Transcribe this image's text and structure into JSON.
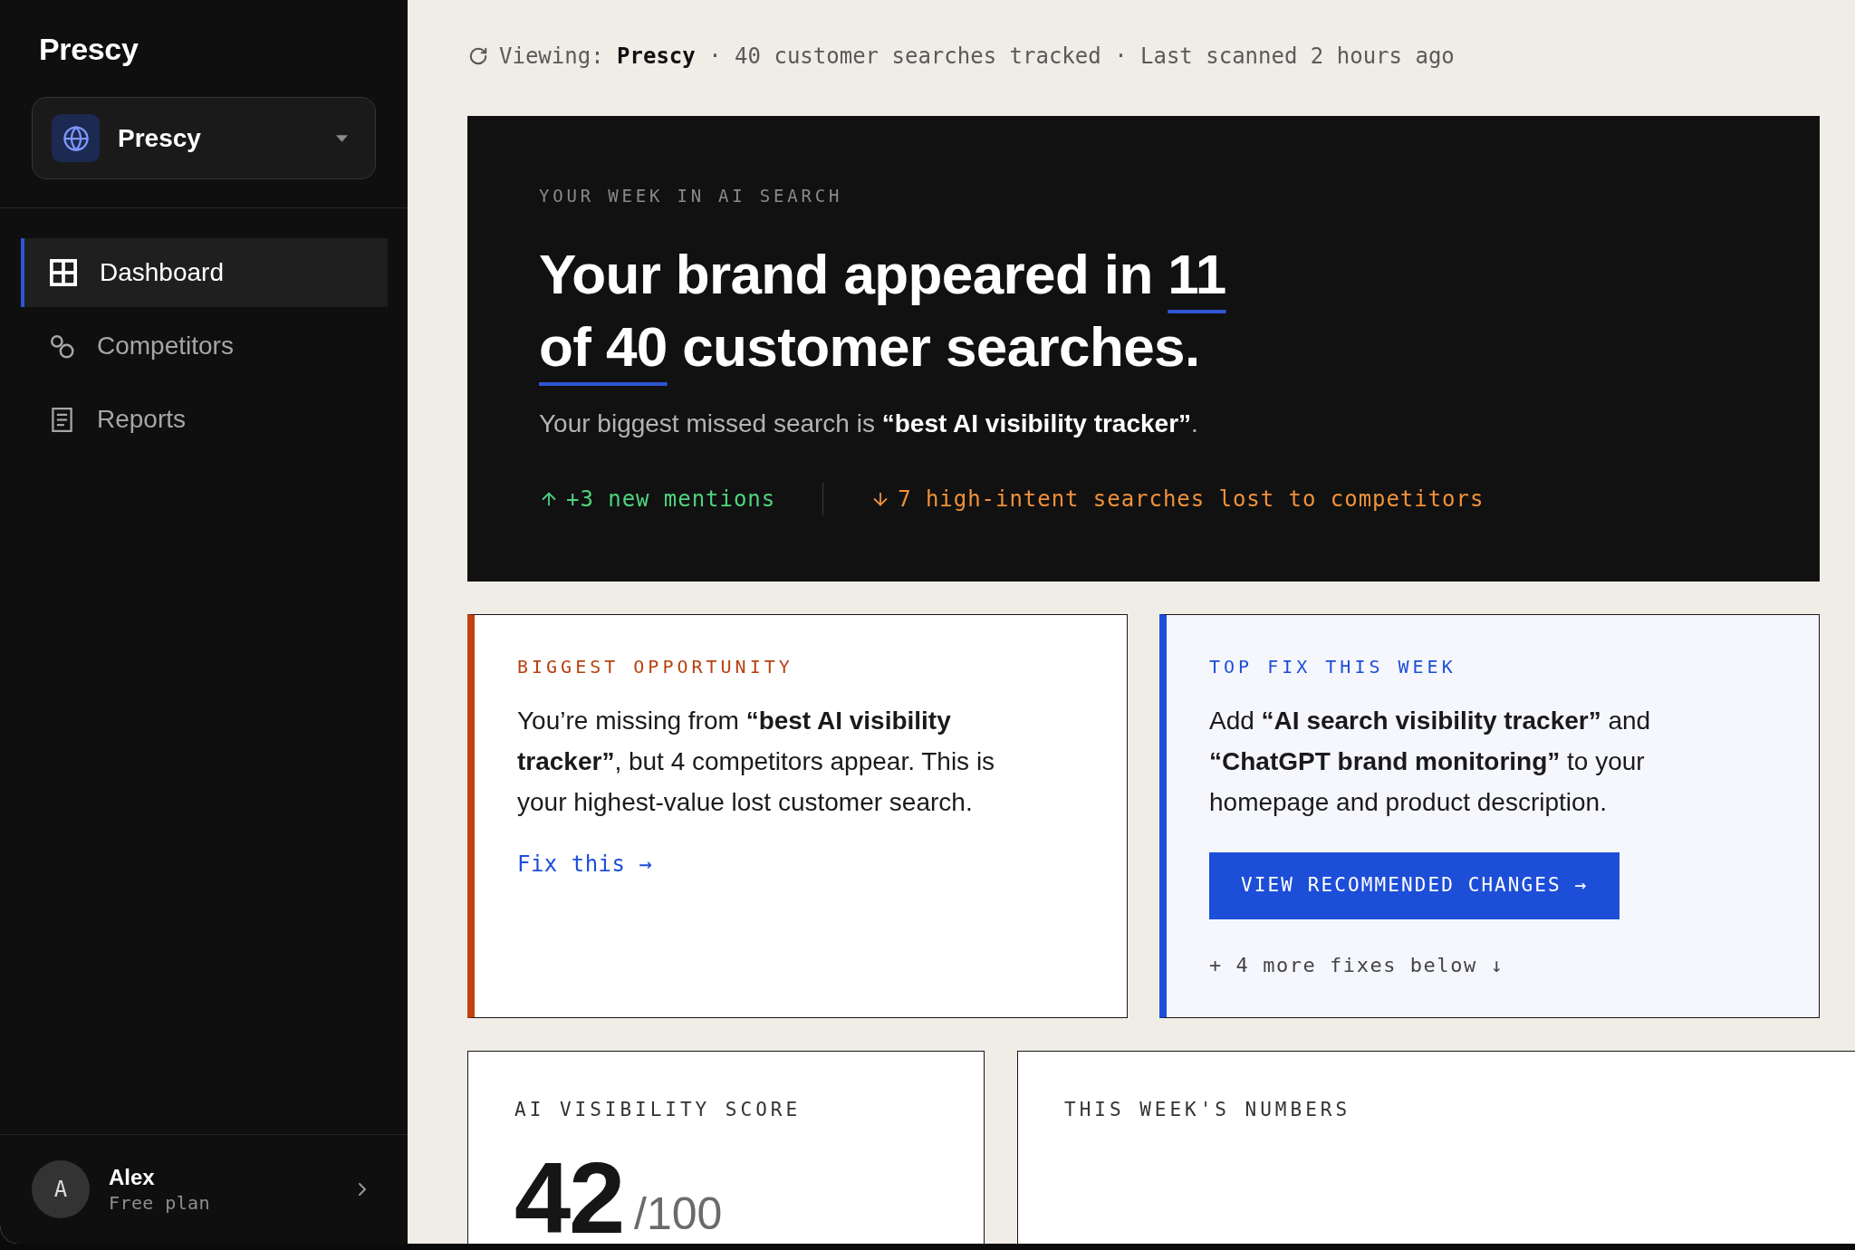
{
  "sidebar": {
    "brand": "Prescy",
    "site_switcher": {
      "label": "Prescy"
    },
    "nav": [
      {
        "label": "Dashboard",
        "selected": true
      },
      {
        "label": "Competitors",
        "selected": false
      },
      {
        "label": "Reports",
        "selected": false
      }
    ],
    "user": {
      "initial": "A",
      "name": "Alex",
      "plan": "Free plan"
    }
  },
  "status_line": "Viewing: **Prescy** · 40 customer searches tracked · Last scanned 2 hours ago",
  "hero": {
    "eyebrow": "YOUR WEEK IN AI SEARCH",
    "headline": {
      "before": "Your brand appeared in ",
      "highlight": "11 of 40",
      "after": " customer searches."
    },
    "subline": "Your biggest missed search is **“best AI visibility tracker”**.",
    "stats": [
      {
        "kind": "up",
        "text": "+3 new mentions"
      },
      {
        "kind": "down",
        "text": "7 high-intent searches lost to competitors"
      }
    ]
  },
  "opportunity_card": {
    "eyebrow": "BIGGEST OPPORTUNITY",
    "body": "You’re missing from **“best AI visibility tracker”**, but 4 competitors appear. This is your highest-value lost customer search.",
    "link": "Fix this →"
  },
  "top_fix_card": {
    "eyebrow": "TOP FIX THIS WEEK",
    "body": "Add **“AI search visibility tracker”** and **“ChatGPT brand monitoring”** to your homepage and product description.",
    "button": "VIEW RECOMMENDED CHANGES →",
    "more": "+ 4 more fixes below ↓"
  },
  "score_card": {
    "eyebrow": "AI VISIBILITY SCORE",
    "value": "42",
    "max": "/100"
  },
  "numbers_card": {
    "eyebrow": "THIS WEEK'S NUMBERS"
  }
}
